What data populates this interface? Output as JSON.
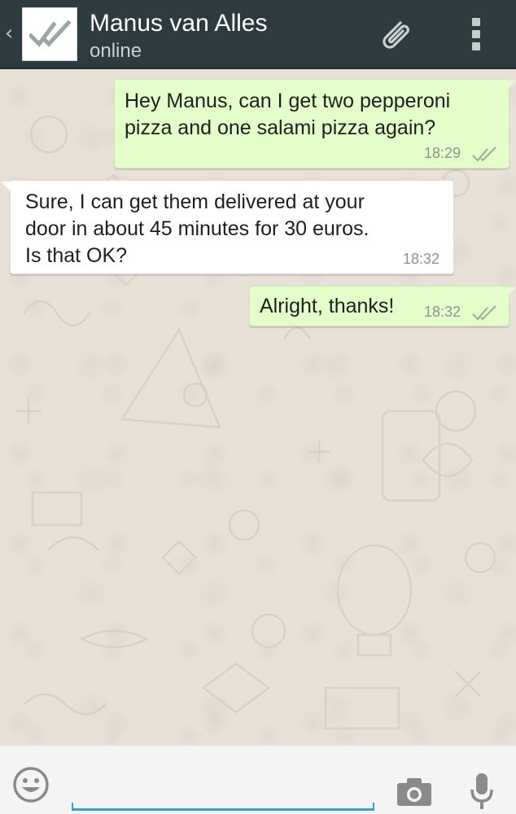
{
  "header": {
    "contact_name": "Manus van Alles",
    "status": "online",
    "icons": [
      "back-chevron-icon",
      "double-check-avatar-icon",
      "paperclip-icon",
      "overflow-menu-icon"
    ]
  },
  "messages": [
    {
      "direction": "outgoing",
      "lines": [
        "Hey Manus, can I get two pepperoni",
        "pizza and one salami pizza again?"
      ],
      "time": "18:29",
      "status_icon": "double-check-icon"
    },
    {
      "direction": "incoming",
      "lines": [
        "Sure, I can get them delivered at your",
        "door in about 45 minutes for 30 euros.",
        "Is that OK?"
      ],
      "time": "18:32"
    },
    {
      "direction": "outgoing",
      "lines": [
        "Alright, thanks!"
      ],
      "time": "18:32",
      "status_icon": "double-check-icon"
    }
  ],
  "input_bar": {
    "value": "",
    "placeholder": "",
    "icons": [
      "emoji-icon",
      "camera-icon",
      "microphone-icon"
    ]
  },
  "colors": {
    "header_bg": "#2d3b3e",
    "chat_bg": "#e8e1d7",
    "outgoing_bubble": "#e3fec8",
    "incoming_bubble": "#ffffff",
    "input_accent": "#33a3d6"
  }
}
